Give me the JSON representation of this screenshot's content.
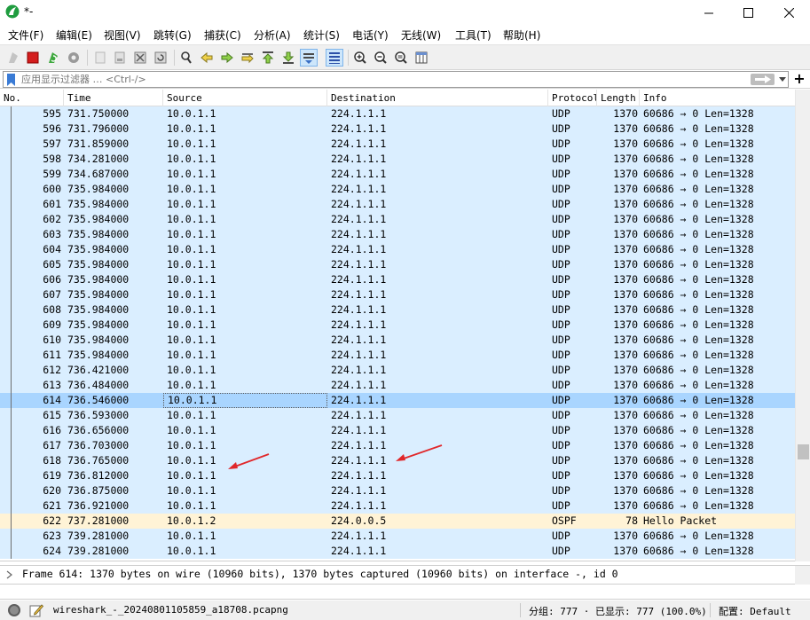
{
  "window": {
    "title": "*-",
    "minimize_label": "minimize",
    "maximize_label": "maximize",
    "close_label": "close"
  },
  "menu": [
    {
      "label": "文件(F)",
      "id": "file"
    },
    {
      "label": "编辑(E)",
      "id": "edit"
    },
    {
      "label": "视图(V)",
      "id": "view"
    },
    {
      "label": "跳转(G)",
      "id": "go"
    },
    {
      "label": "捕获(C)",
      "id": "capture"
    },
    {
      "label": "分析(A)",
      "id": "analyze"
    },
    {
      "label": "统计(S)",
      "id": "statistics"
    },
    {
      "label": "电话(Y)",
      "id": "telephony"
    },
    {
      "label": "无线(W)",
      "id": "wireless"
    },
    {
      "label": "工具(T)",
      "id": "tools"
    },
    {
      "label": "帮助(H)",
      "id": "help"
    }
  ],
  "toolbar": [
    {
      "name": "start-capture-icon",
      "enabled": false
    },
    {
      "name": "stop-capture-icon",
      "enabled": true
    },
    {
      "name": "restart-capture-icon",
      "enabled": true
    },
    {
      "name": "capture-options-icon",
      "enabled": true
    },
    {
      "name": "open-file-icon",
      "enabled": false
    },
    {
      "name": "save-file-icon",
      "enabled": false
    },
    {
      "name": "close-file-icon",
      "enabled": true
    },
    {
      "name": "reload-file-icon",
      "enabled": true
    },
    {
      "name": "find-packet-icon",
      "enabled": true
    },
    {
      "name": "go-back-icon",
      "enabled": true
    },
    {
      "name": "go-forward-icon",
      "enabled": true
    },
    {
      "name": "go-to-packet-icon",
      "enabled": true
    },
    {
      "name": "go-first-packet-icon",
      "enabled": true
    },
    {
      "name": "go-last-packet-icon",
      "enabled": true
    },
    {
      "name": "auto-scroll-icon",
      "enabled": true
    },
    {
      "name": "colorize-icon",
      "enabled": true
    },
    {
      "name": "zoom-in-icon",
      "enabled": true
    },
    {
      "name": "zoom-out-icon",
      "enabled": true
    },
    {
      "name": "zoom-normal-icon",
      "enabled": true
    },
    {
      "name": "resize-columns-icon",
      "enabled": true
    }
  ],
  "filter": {
    "placeholder": "应用显示过滤器 … <Ctrl-/>",
    "value": "",
    "apply_icon": "arrow-right-icon",
    "dropdown_icon": "chevron-down-icon",
    "add_label": "+"
  },
  "packet_list": {
    "columns": [
      "No.",
      "Time",
      "Source",
      "Destination",
      "Protocol",
      "Length",
      "Info"
    ],
    "selected_no": "614",
    "colors": {
      "udp_bg": "#daeeff",
      "ospf_bg": "#fff3d6",
      "selected_bg": "#a9d5ff",
      "selected_cell_border": "#5a5a5a"
    },
    "rows": [
      {
        "no": "595",
        "time": "731.750000",
        "source": "10.0.1.1",
        "destination": "224.1.1.1",
        "protocol": "UDP",
        "length": "1370",
        "info": "60686 → 0 Len=1328"
      },
      {
        "no": "596",
        "time": "731.796000",
        "source": "10.0.1.1",
        "destination": "224.1.1.1",
        "protocol": "UDP",
        "length": "1370",
        "info": "60686 → 0 Len=1328"
      },
      {
        "no": "597",
        "time": "731.859000",
        "source": "10.0.1.1",
        "destination": "224.1.1.1",
        "protocol": "UDP",
        "length": "1370",
        "info": "60686 → 0 Len=1328"
      },
      {
        "no": "598",
        "time": "734.281000",
        "source": "10.0.1.1",
        "destination": "224.1.1.1",
        "protocol": "UDP",
        "length": "1370",
        "info": "60686 → 0 Len=1328"
      },
      {
        "no": "599",
        "time": "734.687000",
        "source": "10.0.1.1",
        "destination": "224.1.1.1",
        "protocol": "UDP",
        "length": "1370",
        "info": "60686 → 0 Len=1328"
      },
      {
        "no": "600",
        "time": "735.984000",
        "source": "10.0.1.1",
        "destination": "224.1.1.1",
        "protocol": "UDP",
        "length": "1370",
        "info": "60686 → 0 Len=1328"
      },
      {
        "no": "601",
        "time": "735.984000",
        "source": "10.0.1.1",
        "destination": "224.1.1.1",
        "protocol": "UDP",
        "length": "1370",
        "info": "60686 → 0 Len=1328"
      },
      {
        "no": "602",
        "time": "735.984000",
        "source": "10.0.1.1",
        "destination": "224.1.1.1",
        "protocol": "UDP",
        "length": "1370",
        "info": "60686 → 0 Len=1328"
      },
      {
        "no": "603",
        "time": "735.984000",
        "source": "10.0.1.1",
        "destination": "224.1.1.1",
        "protocol": "UDP",
        "length": "1370",
        "info": "60686 → 0 Len=1328"
      },
      {
        "no": "604",
        "time": "735.984000",
        "source": "10.0.1.1",
        "destination": "224.1.1.1",
        "protocol": "UDP",
        "length": "1370",
        "info": "60686 → 0 Len=1328"
      },
      {
        "no": "605",
        "time": "735.984000",
        "source": "10.0.1.1",
        "destination": "224.1.1.1",
        "protocol": "UDP",
        "length": "1370",
        "info": "60686 → 0 Len=1328"
      },
      {
        "no": "606",
        "time": "735.984000",
        "source": "10.0.1.1",
        "destination": "224.1.1.1",
        "protocol": "UDP",
        "length": "1370",
        "info": "60686 → 0 Len=1328"
      },
      {
        "no": "607",
        "time": "735.984000",
        "source": "10.0.1.1",
        "destination": "224.1.1.1",
        "protocol": "UDP",
        "length": "1370",
        "info": "60686 → 0 Len=1328"
      },
      {
        "no": "608",
        "time": "735.984000",
        "source": "10.0.1.1",
        "destination": "224.1.1.1",
        "protocol": "UDP",
        "length": "1370",
        "info": "60686 → 0 Len=1328"
      },
      {
        "no": "609",
        "time": "735.984000",
        "source": "10.0.1.1",
        "destination": "224.1.1.1",
        "protocol": "UDP",
        "length": "1370",
        "info": "60686 → 0 Len=1328"
      },
      {
        "no": "610",
        "time": "735.984000",
        "source": "10.0.1.1",
        "destination": "224.1.1.1",
        "protocol": "UDP",
        "length": "1370",
        "info": "60686 → 0 Len=1328"
      },
      {
        "no": "611",
        "time": "735.984000",
        "source": "10.0.1.1",
        "destination": "224.1.1.1",
        "protocol": "UDP",
        "length": "1370",
        "info": "60686 → 0 Len=1328"
      },
      {
        "no": "612",
        "time": "736.421000",
        "source": "10.0.1.1",
        "destination": "224.1.1.1",
        "protocol": "UDP",
        "length": "1370",
        "info": "60686 → 0 Len=1328"
      },
      {
        "no": "613",
        "time": "736.484000",
        "source": "10.0.1.1",
        "destination": "224.1.1.1",
        "protocol": "UDP",
        "length": "1370",
        "info": "60686 → 0 Len=1328"
      },
      {
        "no": "614",
        "time": "736.546000",
        "source": "10.0.1.1",
        "destination": "224.1.1.1",
        "protocol": "UDP",
        "length": "1370",
        "info": "60686 → 0 Len=1328"
      },
      {
        "no": "615",
        "time": "736.593000",
        "source": "10.0.1.1",
        "destination": "224.1.1.1",
        "protocol": "UDP",
        "length": "1370",
        "info": "60686 → 0 Len=1328"
      },
      {
        "no": "616",
        "time": "736.656000",
        "source": "10.0.1.1",
        "destination": "224.1.1.1",
        "protocol": "UDP",
        "length": "1370",
        "info": "60686 → 0 Len=1328"
      },
      {
        "no": "617",
        "time": "736.703000",
        "source": "10.0.1.1",
        "destination": "224.1.1.1",
        "protocol": "UDP",
        "length": "1370",
        "info": "60686 → 0 Len=1328"
      },
      {
        "no": "618",
        "time": "736.765000",
        "source": "10.0.1.1",
        "destination": "224.1.1.1",
        "protocol": "UDP",
        "length": "1370",
        "info": "60686 → 0 Len=1328"
      },
      {
        "no": "619",
        "time": "736.812000",
        "source": "10.0.1.1",
        "destination": "224.1.1.1",
        "protocol": "UDP",
        "length": "1370",
        "info": "60686 → 0 Len=1328"
      },
      {
        "no": "620",
        "time": "736.875000",
        "source": "10.0.1.1",
        "destination": "224.1.1.1",
        "protocol": "UDP",
        "length": "1370",
        "info": "60686 → 0 Len=1328"
      },
      {
        "no": "621",
        "time": "736.921000",
        "source": "10.0.1.1",
        "destination": "224.1.1.1",
        "protocol": "UDP",
        "length": "1370",
        "info": "60686 → 0 Len=1328"
      },
      {
        "no": "622",
        "time": "737.281000",
        "source": "10.0.1.2",
        "destination": "224.0.0.5",
        "protocol": "OSPF",
        "length": "78",
        "info": "Hello Packet"
      },
      {
        "no": "623",
        "time": "739.281000",
        "source": "10.0.1.1",
        "destination": "224.1.1.1",
        "protocol": "UDP",
        "length": "1370",
        "info": "60686 → 0 Len=1328"
      },
      {
        "no": "624",
        "time": "739.281000",
        "source": "10.0.1.1",
        "destination": "224.1.1.1",
        "protocol": "UDP",
        "length": "1370",
        "info": "60686 → 0 Len=1328"
      }
    ]
  },
  "details": {
    "frame_summary": "Frame 614: 1370 bytes on wire (10960 bits), 1370 bytes captured (10960 bits) on interface -, id 0"
  },
  "status": {
    "file_name": "wireshark_-_20240801105859_a18708.pcapng",
    "packets_label": "分组: 777 · 已显示: 777 (100.0%)",
    "profile_label": "配置: Default"
  },
  "annotations": {
    "arrow_color": "#e0272a",
    "arrows": [
      "source-column-arrow",
      "destination-column-arrow"
    ]
  }
}
